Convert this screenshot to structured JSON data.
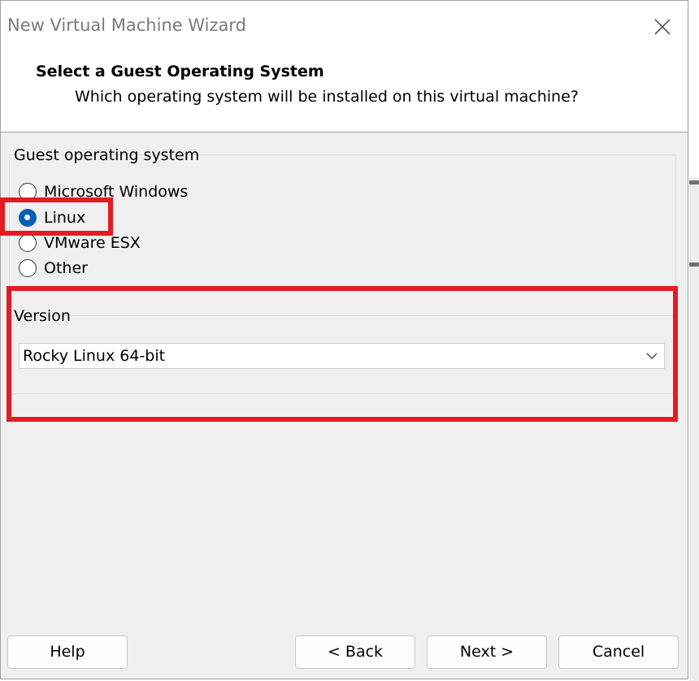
{
  "window": {
    "title": "New Virtual Machine Wizard",
    "close_icon": "close-icon"
  },
  "header": {
    "title": "Select a Guest Operating System",
    "subtitle": "Which operating system will be installed on this virtual machine?"
  },
  "guest_os": {
    "group_label": "Guest operating system",
    "options": [
      {
        "label": "Microsoft Windows",
        "selected": false
      },
      {
        "label": "Linux",
        "selected": true
      },
      {
        "label": "VMware ESX",
        "selected": false
      },
      {
        "label": "Other",
        "selected": false
      }
    ]
  },
  "version": {
    "label": "Version",
    "selected": "Rocky Linux 64-bit"
  },
  "buttons": {
    "help": "Help",
    "back": "< Back",
    "next": "Next >",
    "cancel": "Cancel"
  },
  "colors": {
    "accent": "#005fb8",
    "annotation": "#e31b23"
  }
}
